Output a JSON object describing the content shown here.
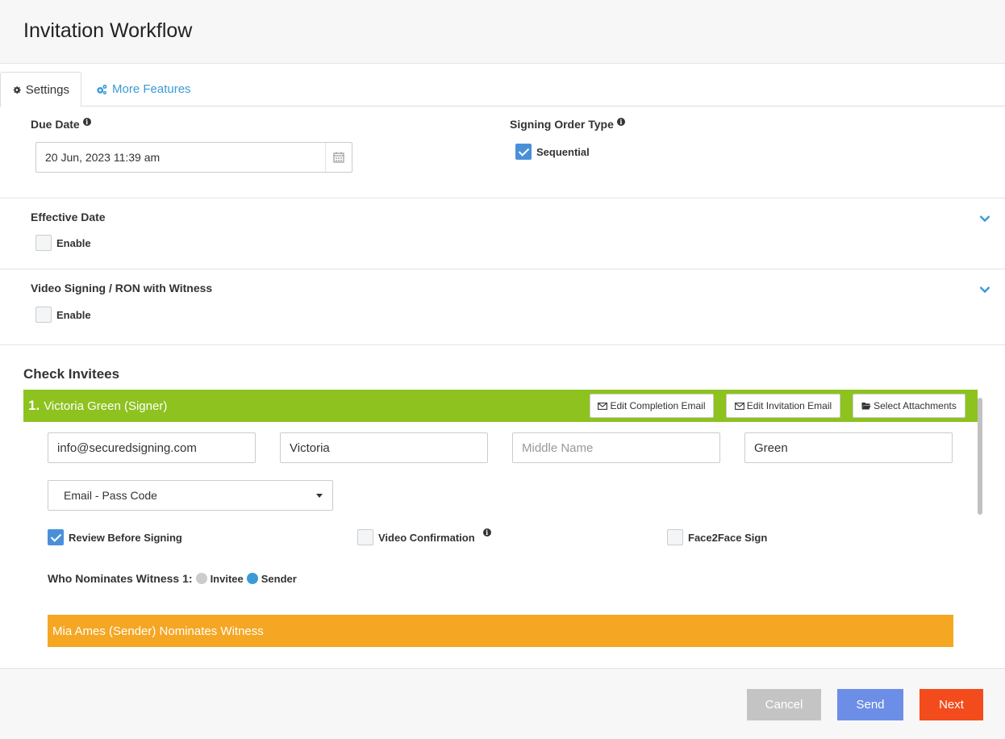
{
  "header": {
    "title": "Invitation Workflow"
  },
  "tabs": [
    {
      "label": "Settings",
      "icon": "gear-icon",
      "active": true
    },
    {
      "label": "More Features",
      "icon": "gears-icon",
      "active": false
    }
  ],
  "due_date": {
    "label": "Due Date",
    "value": "20 Jun, 2023 11:39 am"
  },
  "signing_order": {
    "label": "Signing Order Type",
    "option_label": "Sequential",
    "checked": true
  },
  "effective_date": {
    "label": "Effective Date",
    "enable_label": "Enable",
    "checked": false
  },
  "video_signing": {
    "label": "Video Signing / RON with Witness",
    "enable_label": "Enable",
    "checked": false
  },
  "check_invitees": {
    "title": "Check Invitees",
    "invitee": {
      "number": "1.",
      "name": "Victoria Green (Signer)",
      "buttons": {
        "edit_completion": "Edit Completion Email",
        "edit_invitation": "Edit Invitation Email",
        "select_attachments": "Select Attachments"
      },
      "email": "info@securedsigning.com",
      "first_name": "Victoria",
      "middle_name_placeholder": "Middle Name",
      "last_name": "Green",
      "auth_method": "Email - Pass Code",
      "review_before_signing": {
        "label": "Review Before Signing",
        "checked": true
      },
      "video_confirmation": {
        "label": "Video Confirmation",
        "checked": false
      },
      "face2face": {
        "label": "Face2Face Sign",
        "checked": false
      },
      "witness": {
        "label": "Who Nominates Witness 1:",
        "options": [
          {
            "label": "Invitee",
            "selected": false
          },
          {
            "label": "Sender",
            "selected": true
          }
        ]
      },
      "nominates_banner": "Mia Ames (Sender) Nominates Witness"
    }
  },
  "footer": {
    "cancel": "Cancel",
    "send": "Send",
    "next": "Next"
  },
  "colors": {
    "green_bar": "#8dc21f",
    "orange_bar": "#f5a623",
    "cancel": "#c4c4c4",
    "send": "#6c8ee6",
    "next": "#f44b1c",
    "link": "#3a9bd5"
  }
}
